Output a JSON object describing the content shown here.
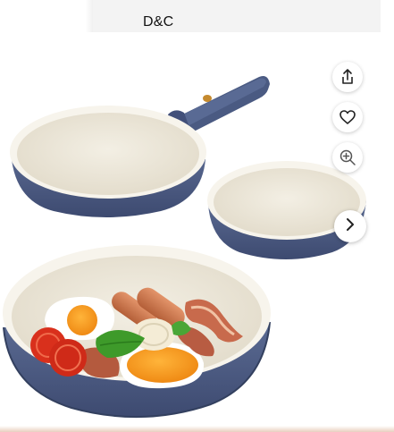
{
  "header": {
    "brand": "D&C"
  },
  "gallery": {
    "product_image": "frying-pan-set-photo",
    "actions": [
      {
        "name": "share",
        "icon": "share-icon"
      },
      {
        "name": "wishlist",
        "icon": "heart-icon"
      },
      {
        "name": "zoom",
        "icon": "zoom-in-icon"
      }
    ],
    "next_icon": "chevron-right-icon"
  },
  "colors": {
    "pan_blue": "#4d5d86",
    "pan_blue_dark": "#3a476b",
    "ceramic_cream": "#ece6d8",
    "background": "#ffffff"
  }
}
